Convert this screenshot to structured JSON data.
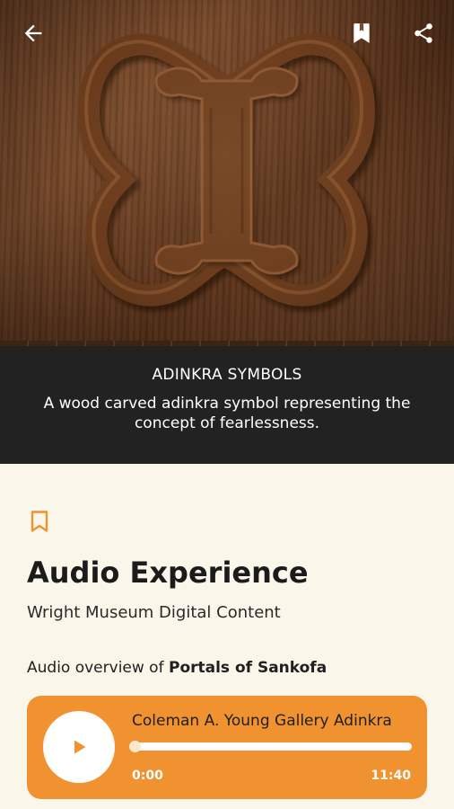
{
  "hero": {
    "image_alt": "wood-carved-adinkra-symbol"
  },
  "caption": {
    "title": "ADINKRA SYMBOLS",
    "description": "A wood carved adinkra symbol representing the concept of fearlessness."
  },
  "content": {
    "title": "Audio Experience",
    "subtitle": "Wright Museum Digital Content",
    "overview_prefix": "Audio overview of ",
    "overview_subject": "Portals of Sankofa"
  },
  "player": {
    "track_title": "Coleman A. Young Gallery Adinkra",
    "current_time": "0:00",
    "total_time": "11:40",
    "progress": 0.0
  },
  "icons": {
    "back": "arrow-left-icon",
    "hero_bookmark": "bookmark-filled-icon",
    "share": "share-icon",
    "content_bookmark": "bookmark-outline-icon",
    "play": "play-icon"
  },
  "colors": {
    "accent": "#f0922f",
    "caption_bg": "#222222",
    "page_bg": "#fbf6ea"
  }
}
